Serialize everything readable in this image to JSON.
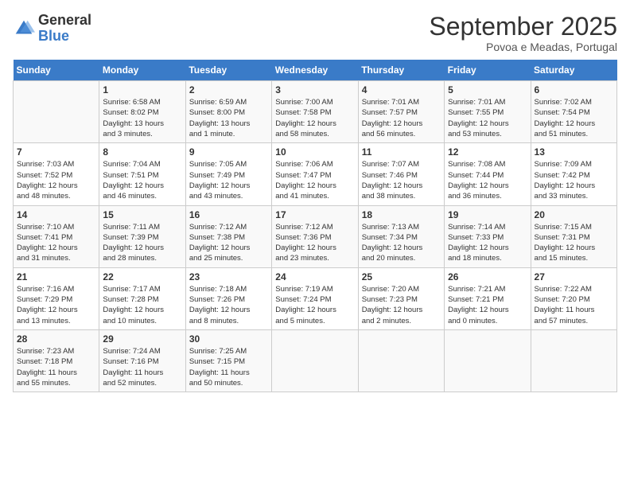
{
  "header": {
    "logo_general": "General",
    "logo_blue": "Blue",
    "month_title": "September 2025",
    "subtitle": "Povoa e Meadas, Portugal"
  },
  "weekdays": [
    "Sunday",
    "Monday",
    "Tuesday",
    "Wednesday",
    "Thursday",
    "Friday",
    "Saturday"
  ],
  "weeks": [
    [
      {
        "day": "",
        "info": ""
      },
      {
        "day": "1",
        "info": "Sunrise: 6:58 AM\nSunset: 8:02 PM\nDaylight: 13 hours\nand 3 minutes."
      },
      {
        "day": "2",
        "info": "Sunrise: 6:59 AM\nSunset: 8:00 PM\nDaylight: 13 hours\nand 1 minute."
      },
      {
        "day": "3",
        "info": "Sunrise: 7:00 AM\nSunset: 7:58 PM\nDaylight: 12 hours\nand 58 minutes."
      },
      {
        "day": "4",
        "info": "Sunrise: 7:01 AM\nSunset: 7:57 PM\nDaylight: 12 hours\nand 56 minutes."
      },
      {
        "day": "5",
        "info": "Sunrise: 7:01 AM\nSunset: 7:55 PM\nDaylight: 12 hours\nand 53 minutes."
      },
      {
        "day": "6",
        "info": "Sunrise: 7:02 AM\nSunset: 7:54 PM\nDaylight: 12 hours\nand 51 minutes."
      }
    ],
    [
      {
        "day": "7",
        "info": "Sunrise: 7:03 AM\nSunset: 7:52 PM\nDaylight: 12 hours\nand 48 minutes."
      },
      {
        "day": "8",
        "info": "Sunrise: 7:04 AM\nSunset: 7:51 PM\nDaylight: 12 hours\nand 46 minutes."
      },
      {
        "day": "9",
        "info": "Sunrise: 7:05 AM\nSunset: 7:49 PM\nDaylight: 12 hours\nand 43 minutes."
      },
      {
        "day": "10",
        "info": "Sunrise: 7:06 AM\nSunset: 7:47 PM\nDaylight: 12 hours\nand 41 minutes."
      },
      {
        "day": "11",
        "info": "Sunrise: 7:07 AM\nSunset: 7:46 PM\nDaylight: 12 hours\nand 38 minutes."
      },
      {
        "day": "12",
        "info": "Sunrise: 7:08 AM\nSunset: 7:44 PM\nDaylight: 12 hours\nand 36 minutes."
      },
      {
        "day": "13",
        "info": "Sunrise: 7:09 AM\nSunset: 7:42 PM\nDaylight: 12 hours\nand 33 minutes."
      }
    ],
    [
      {
        "day": "14",
        "info": "Sunrise: 7:10 AM\nSunset: 7:41 PM\nDaylight: 12 hours\nand 31 minutes."
      },
      {
        "day": "15",
        "info": "Sunrise: 7:11 AM\nSunset: 7:39 PM\nDaylight: 12 hours\nand 28 minutes."
      },
      {
        "day": "16",
        "info": "Sunrise: 7:12 AM\nSunset: 7:38 PM\nDaylight: 12 hours\nand 25 minutes."
      },
      {
        "day": "17",
        "info": "Sunrise: 7:12 AM\nSunset: 7:36 PM\nDaylight: 12 hours\nand 23 minutes."
      },
      {
        "day": "18",
        "info": "Sunrise: 7:13 AM\nSunset: 7:34 PM\nDaylight: 12 hours\nand 20 minutes."
      },
      {
        "day": "19",
        "info": "Sunrise: 7:14 AM\nSunset: 7:33 PM\nDaylight: 12 hours\nand 18 minutes."
      },
      {
        "day": "20",
        "info": "Sunrise: 7:15 AM\nSunset: 7:31 PM\nDaylight: 12 hours\nand 15 minutes."
      }
    ],
    [
      {
        "day": "21",
        "info": "Sunrise: 7:16 AM\nSunset: 7:29 PM\nDaylight: 12 hours\nand 13 minutes."
      },
      {
        "day": "22",
        "info": "Sunrise: 7:17 AM\nSunset: 7:28 PM\nDaylight: 12 hours\nand 10 minutes."
      },
      {
        "day": "23",
        "info": "Sunrise: 7:18 AM\nSunset: 7:26 PM\nDaylight: 12 hours\nand 8 minutes."
      },
      {
        "day": "24",
        "info": "Sunrise: 7:19 AM\nSunset: 7:24 PM\nDaylight: 12 hours\nand 5 minutes."
      },
      {
        "day": "25",
        "info": "Sunrise: 7:20 AM\nSunset: 7:23 PM\nDaylight: 12 hours\nand 2 minutes."
      },
      {
        "day": "26",
        "info": "Sunrise: 7:21 AM\nSunset: 7:21 PM\nDaylight: 12 hours\nand 0 minutes."
      },
      {
        "day": "27",
        "info": "Sunrise: 7:22 AM\nSunset: 7:20 PM\nDaylight: 11 hours\nand 57 minutes."
      }
    ],
    [
      {
        "day": "28",
        "info": "Sunrise: 7:23 AM\nSunset: 7:18 PM\nDaylight: 11 hours\nand 55 minutes."
      },
      {
        "day": "29",
        "info": "Sunrise: 7:24 AM\nSunset: 7:16 PM\nDaylight: 11 hours\nand 52 minutes."
      },
      {
        "day": "30",
        "info": "Sunrise: 7:25 AM\nSunset: 7:15 PM\nDaylight: 11 hours\nand 50 minutes."
      },
      {
        "day": "",
        "info": ""
      },
      {
        "day": "",
        "info": ""
      },
      {
        "day": "",
        "info": ""
      },
      {
        "day": "",
        "info": ""
      }
    ]
  ]
}
